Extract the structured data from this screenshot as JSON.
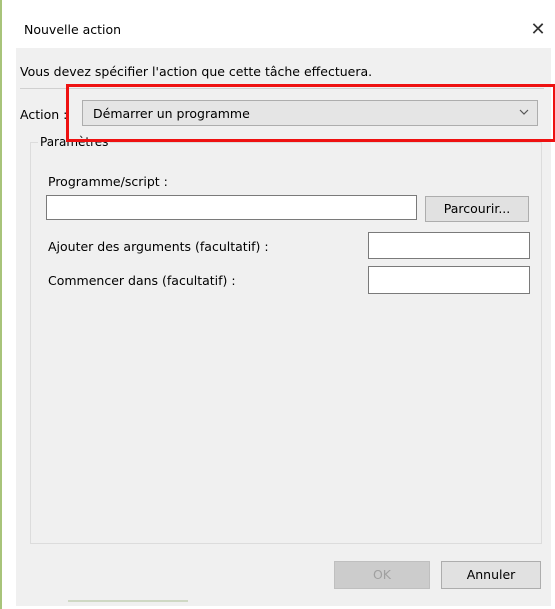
{
  "window": {
    "title": "Nouvelle action",
    "close_glyph": "✕"
  },
  "instruction": "Vous devez spécifier l'action que cette tâche effectuera.",
  "action": {
    "label": "Action :",
    "selected_value": "Démarrer un programme"
  },
  "parameters": {
    "group_label": "Paramètres",
    "program_label": "Programme/script :",
    "program_value": "",
    "browse_label": "Parcourir...",
    "arguments_label": "Ajouter des arguments (facultatif) :",
    "arguments_value": "",
    "start_in_label": "Commencer dans (facultatif) :",
    "start_in_value": ""
  },
  "buttons": {
    "ok_label": "OK",
    "cancel_label": "Annuler"
  },
  "colors": {
    "highlight": "#ee1111",
    "dialog_background": "#f0f0f0"
  },
  "icons": {
    "close": "close-icon",
    "dropdown": "chevron-down-icon"
  }
}
